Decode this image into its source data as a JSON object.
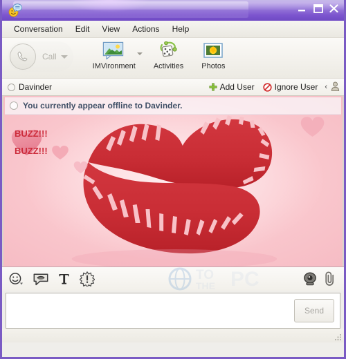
{
  "window": {
    "title": "",
    "app_icon": "yahoo-messenger-smiley-icon",
    "controls": {
      "minimize": "Minimize",
      "maximize": "Maximize",
      "close": "Close"
    },
    "accent_color": "#7a5bc4",
    "titlebar_color": "#8f6ed6"
  },
  "menubar": {
    "items": [
      {
        "label": "Conversation"
      },
      {
        "label": "Edit"
      },
      {
        "label": "View"
      },
      {
        "label": "Actions"
      },
      {
        "label": "Help"
      }
    ]
  },
  "toolbar": {
    "call": {
      "label": "Call",
      "icon": "phone-icon",
      "disabled": true,
      "has_dropdown": true
    },
    "buttons": [
      {
        "label": "IMVironment",
        "icon": "imvironment-icon",
        "has_dropdown": true
      },
      {
        "label": "Activities",
        "icon": "activities-dice-icon",
        "has_dropdown": false
      },
      {
        "label": "Photos",
        "icon": "photos-icon",
        "has_dropdown": false
      }
    ]
  },
  "userbar": {
    "contact_name": "Davinder",
    "contact_status_icon": "offline-status-dot",
    "add_user": {
      "label": "Add User",
      "icon": "plus-icon",
      "color": "#8dc63f"
    },
    "ignore_user": {
      "label": "Ignore User",
      "icon": "ignore-icon",
      "color": "#d22b2b"
    },
    "collapse_chevron": "‹",
    "contact_icon": "contact-person-icon"
  },
  "conversation": {
    "offline_notice": "You currently appear offline to Davinder.",
    "offline_icon": "offline-status-dot",
    "background_color": "#f9cbd0",
    "imvironment_name": "kiss-lips-imvironment",
    "messages": [
      {
        "text": "BUZZ!!!",
        "color": "#cc2b3b"
      },
      {
        "text": "BUZZ!!!",
        "color": "#cc2b3b"
      }
    ]
  },
  "input_toolbar": {
    "buttons": [
      {
        "name": "emoticons",
        "icon": "smiley-icon",
        "has_dropdown": true
      },
      {
        "name": "audibles",
        "icon": "speech-bubble-icon",
        "has_dropdown": false
      },
      {
        "name": "text-format",
        "icon": "text-format-T-icon",
        "has_dropdown": false
      },
      {
        "name": "buzz",
        "icon": "buzz-star-icon",
        "has_dropdown": false
      }
    ],
    "right_buttons": [
      {
        "name": "webcam",
        "icon": "webcam-icon"
      },
      {
        "name": "attach-file",
        "icon": "paperclip-icon"
      }
    ],
    "watermark": {
      "line1": "TO",
      "line2": "THE",
      "line3": "PC"
    }
  },
  "compose": {
    "value": "",
    "placeholder": "",
    "send_label": "Send",
    "send_disabled": true
  }
}
